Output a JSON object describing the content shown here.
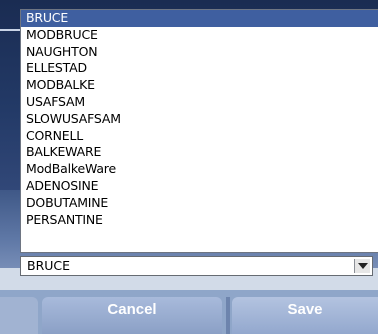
{
  "dropdown": {
    "selected_index": 0,
    "options": [
      "BRUCE",
      "MODBRUCE",
      "NAUGHTON",
      "ELLESTAD",
      "MODBALKE",
      "USAFSAM",
      "SLOWUSAFSAM",
      "CORNELL",
      "BALKEWARE",
      "ModBalkeWare",
      "ADENOSINE",
      "DOBUTAMINE",
      "PERSANTINE"
    ]
  },
  "select": {
    "value": "BRUCE",
    "arrow_icon": "chevron-down-icon"
  },
  "buttons": {
    "cancel_label": "Cancel",
    "save_label": "Save"
  },
  "colors": {
    "selection": "#3f5fa0",
    "background": "#1b2f55",
    "button": "#8fa6c9"
  }
}
